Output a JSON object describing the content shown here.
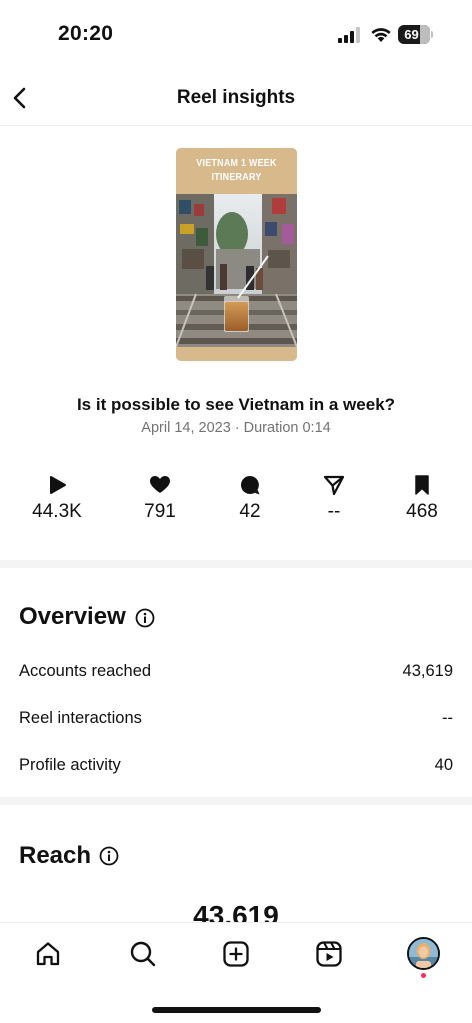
{
  "status_bar": {
    "time": "20:20",
    "battery": "69"
  },
  "header": {
    "title": "Reel insights"
  },
  "reel": {
    "cover_text": "Vietnam 1 week itinerary",
    "title": "Is it possible to see Vietnam in a week?",
    "meta": "April 14, 2023 · Duration 0:14"
  },
  "stats": [
    {
      "icon": "play-icon",
      "value": "44.3K"
    },
    {
      "icon": "heart-icon",
      "value": "791"
    },
    {
      "icon": "comment-icon",
      "value": "42"
    },
    {
      "icon": "send-icon",
      "value": "--"
    },
    {
      "icon": "bookmark-icon",
      "value": "468"
    }
  ],
  "overview": {
    "title": "Overview",
    "rows": [
      {
        "label": "Accounts reached",
        "value": "43,619"
      },
      {
        "label": "Reel interactions",
        "value": "--"
      },
      {
        "label": "Profile activity",
        "value": "40"
      }
    ]
  },
  "reach": {
    "title": "Reach",
    "number": "43,619"
  },
  "bottom_nav": [
    "home-icon",
    "search-icon",
    "create-icon",
    "reels-icon",
    "profile-avatar"
  ],
  "colors": {
    "cover_tan": "#d8b98c",
    "meta_gray": "#737373",
    "notification_dot": "#ff2d55"
  }
}
